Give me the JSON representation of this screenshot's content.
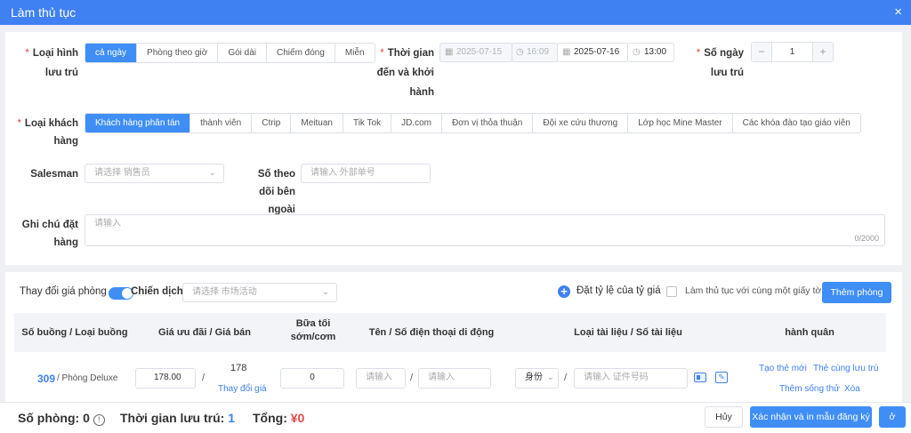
{
  "dialog": {
    "title": "Làm thủ tục",
    "close_icon": "×"
  },
  "stay": {
    "type_label": "Loại hình lưu trú",
    "types": [
      "cả ngày",
      "Phòng theo giờ",
      "Gói dài",
      "Chiếm đóng",
      "Miễn"
    ],
    "time_label": "Thời gian đến và khởi hành",
    "start_date": "2025-07-15",
    "start_time": "16:09",
    "end_date": "2025-07-16",
    "end_time": "13:00",
    "days_label": "Số ngày lưu trú",
    "days": "1",
    "minus": "−",
    "plus": "+"
  },
  "customer": {
    "label": "Loại khách hàng",
    "types": [
      "Khách hàng phân tán",
      "thành viên",
      "Ctrip",
      "Meituan",
      "Tik Tok",
      "JD.com",
      "Đơn vị thỏa thuận",
      "Đội xe cứu thương",
      "Lớp học Mine Master",
      "Các khóa đào tạo giáo viên"
    ]
  },
  "salesman": {
    "label": "Salesman",
    "placeholder": "请选择 销售员"
  },
  "external": {
    "label": "Số theo dõi bên ngoài",
    "placeholder": "请输入 外部单号"
  },
  "note": {
    "label": "Ghi chú đặt hàng",
    "placeholder": "请输入",
    "counter": "0/2000"
  },
  "rooms": {
    "price_change_label": "Thay đổi giá phòng",
    "campaign_label": "Chiến dịch",
    "campaign_placeholder": "请选择 市场活动",
    "rate_label": "Đặt tỷ lệ của tỷ giá",
    "same_doc_label": "Làm thủ tục với cùng một giấy tờ",
    "add_room": "Thêm phòng",
    "headers": [
      "Số buồng / Loại buồng",
      "Giá ưu đãi / Giá bán",
      "Bữa tối sớm/cơm",
      "Tên / Số điện thoại di động",
      "Loại tài liệu / Số tài liệu",
      "hành quân"
    ],
    "row": {
      "room_no": "309",
      "room_type": "/ Phòng Deluxe",
      "price": "178.00",
      "sale_price": "178",
      "change_price": "Thay đổi giá",
      "meal": "0",
      "name_ph": "请输入",
      "phone_ph": "请输入",
      "doc_type": "身份",
      "doc_ph": "请输入 证件号码",
      "actions": [
        "Tạo thẻ mới",
        "Thẻ cùng lưu trú",
        "Thêm sống thử",
        "Xóa"
      ],
      "sep": "/"
    }
  },
  "footer": {
    "rooms_label": "Số phòng:",
    "rooms_value": "0",
    "stay_label": "Thời gian lưu trú:",
    "stay_value": "1",
    "total_label": "Tổng:",
    "total_value": "¥0",
    "cancel": "Hủy",
    "confirm_print": "Xác nhận và in mẫu đăng ký",
    "confirm": "ở"
  },
  "colors": {
    "accent": "#3f8ef5",
    "title_bar": "#3f80f2",
    "total": "#e64545",
    "required": "#e64545"
  }
}
